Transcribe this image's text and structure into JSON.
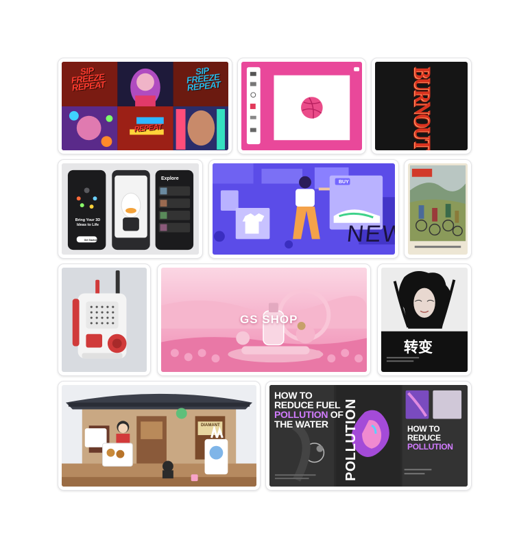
{
  "gallery": {
    "accent": "#ea4c89",
    "cards": [
      {
        "id": "sip-freeze",
        "texts": [
          "SIP",
          "FREEZE",
          "REPEAT"
        ]
      },
      {
        "id": "dribbble-editor"
      },
      {
        "id": "burnout",
        "texts": [
          "BURNOUT"
        ]
      },
      {
        "id": "3d-app",
        "texts": [
          "Bring Your 3D",
          "Ideas to Life",
          "Get Started",
          "Explore"
        ]
      },
      {
        "id": "shopping-illustration",
        "texts": [
          "BUY",
          "NEW"
        ]
      },
      {
        "id": "cyclists-poster"
      },
      {
        "id": "walkie-talkie"
      },
      {
        "id": "gs-shop",
        "texts": [
          "GS SHOP"
        ]
      },
      {
        "id": "transform-poster",
        "texts": [
          "转变"
        ]
      },
      {
        "id": "korean-house",
        "texts": [
          "DIAMANT"
        ]
      },
      {
        "id": "pollution-posters",
        "texts": [
          "HOW TO",
          "REDUCE FUEL",
          "POLLUTION",
          "OF",
          "THE WATER",
          "POLLUTION",
          "HOW TO REDUCE",
          "POLLUTION"
        ]
      }
    ]
  }
}
